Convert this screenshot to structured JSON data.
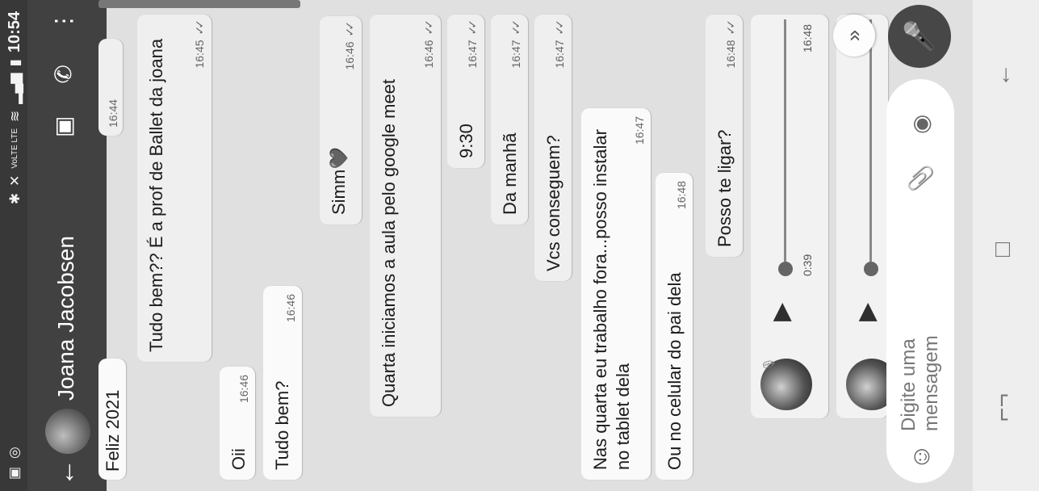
{
  "status_bar": {
    "time": "10:54",
    "network": "VoLTE LTE"
  },
  "header": {
    "contact_name": "Joana Jacobsen"
  },
  "chat": {
    "date_fragment": "Feliz 2021",
    "fragment_time": "16:44",
    "messages": [
      {
        "text": "Tudo bem?? É a prof de Ballet da joana",
        "time": "16:45",
        "ticks": "✓✓"
      },
      {
        "text": "Oii",
        "time": "16:46"
      },
      {
        "text": "Tudo bem?",
        "time": "16:46"
      },
      {
        "text": "Simm💜",
        "time": "16:46",
        "ticks": "✓✓"
      },
      {
        "text": "Quarta iniciamos a aula pelo google meet",
        "time": "16:46",
        "ticks": "✓✓"
      },
      {
        "text": "9:30",
        "time": "16:47",
        "ticks": "✓✓"
      },
      {
        "text": "Da manhã",
        "time": "16:47",
        "ticks": "✓✓"
      },
      {
        "text": "Vcs conseguem?",
        "time": "16:47",
        "ticks": "✓✓"
      },
      {
        "text": "Nas quarta eu trabalho fora...posso instalar no tablet dela",
        "time": "16:47"
      },
      {
        "text": "Ou no celular do pai dela",
        "time": "16:48"
      },
      {
        "text": "Posso te ligar?",
        "time": "16:48",
        "ticks": "✓✓"
      }
    ],
    "voice_notes": [
      {
        "duration": "0:39",
        "time": "16:48"
      },
      {
        "duration": "",
        "time": ""
      }
    ]
  },
  "input": {
    "placeholder": "Digite uma mensagem"
  },
  "icons": {
    "back": "arrow-left-icon",
    "video": "video-call-icon",
    "call": "add-call-icon",
    "menu": "more-vert-icon",
    "emoji": "emoji-icon",
    "attach": "paperclip-icon",
    "camera": "camera-icon",
    "mic": "mic-icon",
    "scroll": "double-chevron-icon"
  }
}
